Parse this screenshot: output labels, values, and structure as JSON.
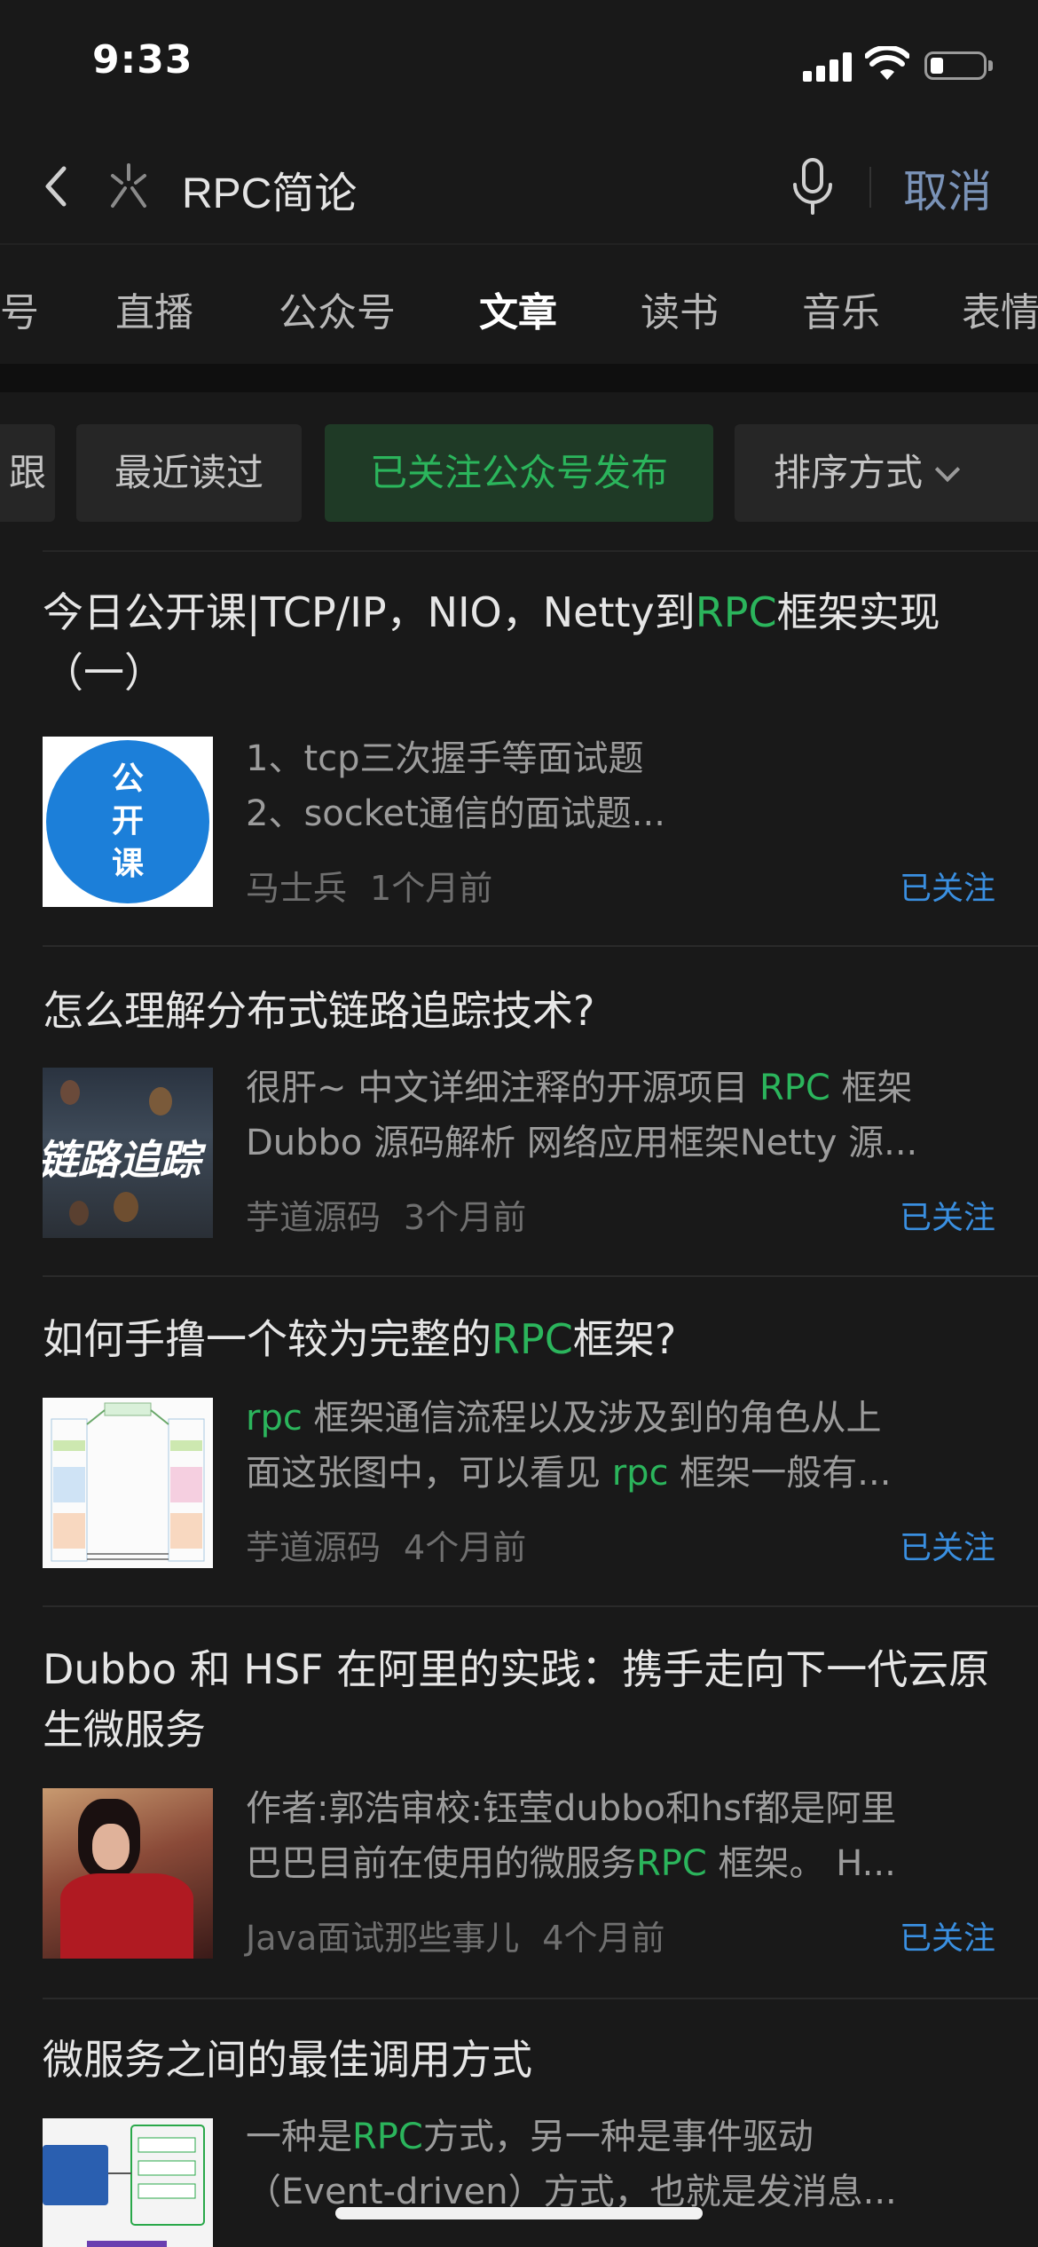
{
  "status_bar": {
    "time": "9:33"
  },
  "search": {
    "query": "RPC简论",
    "cancel_label": "取消"
  },
  "tabs": [
    {
      "label": "号"
    },
    {
      "label": "直播"
    },
    {
      "label": "公众号"
    },
    {
      "label": "文章"
    },
    {
      "label": "读书"
    },
    {
      "label": "音乐"
    },
    {
      "label": "表情"
    }
  ],
  "active_tab": "文章",
  "filters": [
    {
      "label": "跟"
    },
    {
      "label": "最近读过"
    },
    {
      "label": "已关注公众号发布"
    },
    {
      "label": "排序方式"
    }
  ],
  "colors": {
    "highlight": "#2bb55c",
    "follow": "#3a8fe0",
    "background": "#191919"
  },
  "articles": [
    {
      "title_pre": "今日公开课|TCP/IP，NIO，Netty到",
      "title_hl": "RPC",
      "title_post": "框架实现（一）",
      "desc_line1": "1、tcp三次握手等面试题",
      "desc_line2": "2、socket通信的面试题...",
      "source": "马士兵",
      "time": "1个月前",
      "follow": "已关注",
      "thumb_text": [
        "公",
        "开",
        "课"
      ]
    },
    {
      "title": "怎么理解分布式链路追踪技术?",
      "desc_line1_pre": "很肝~ 中文详细注释的开源项目 ",
      "desc_line1_hl": "RPC",
      "desc_line1_post": " 框架",
      "desc_line2": "Dubbo 源码解析 网络应用框架Netty 源...",
      "source": "芋道源码",
      "time": "3个月前",
      "follow": "已关注",
      "thumb_text": "链路追踪"
    },
    {
      "title_pre": "如何手撸一个较为完整的",
      "title_hl": "RPC",
      "title_post": "框架?",
      "desc_line1_hl": "rpc",
      "desc_line1_post": " 框架通信流程以及涉及到的角色从上",
      "desc_line2_pre": "面这张图中，可以看见 ",
      "desc_line2_hl": "rpc",
      "desc_line2_post": " 框架一般有...",
      "source": "芋道源码",
      "time": "4个月前",
      "follow": "已关注"
    },
    {
      "title": "Dubbo 和 HSF 在阿里的实践：携手走向下一代云原生微服务",
      "desc_line1": "作者:郭浩审校:钰莹dubbo和hsf都是阿里",
      "desc_line2_pre": "巴巴目前在使用的微服务",
      "desc_line2_hl": "RPC",
      "desc_line2_post": " 框架。 H...",
      "source": "Java面试那些事儿",
      "time": "4个月前",
      "follow": "已关注"
    },
    {
      "title": "微服务之间的最佳调用方式",
      "desc_line1_pre": "一种是",
      "desc_line1_hl": "RPC",
      "desc_line1_post": "方式，另一种是事件驱动",
      "desc_line2": "（Event-driven）方式，也就是发消息..."
    }
  ]
}
